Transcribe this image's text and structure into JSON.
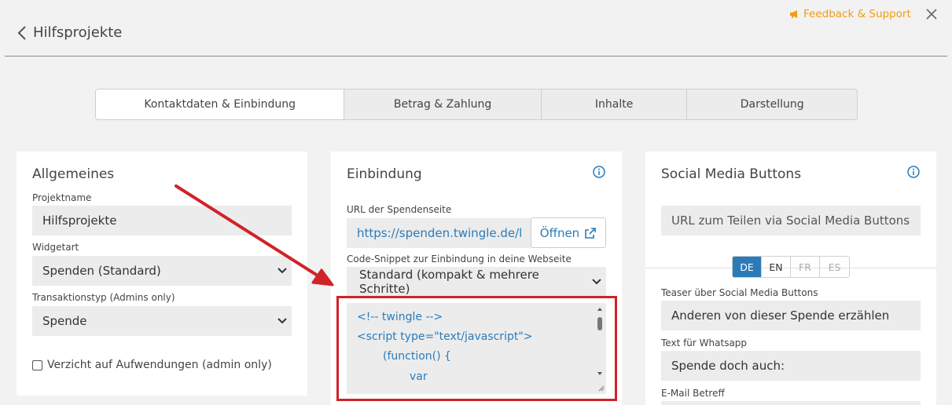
{
  "header": {
    "back_label": "Hilfsprojekte",
    "feedback_label": "Feedback & Support"
  },
  "tabs": [
    {
      "label": "Kontaktdaten & Einbindung",
      "active": true
    },
    {
      "label": "Betrag & Zahlung",
      "active": false
    },
    {
      "label": "Inhalte",
      "active": false
    },
    {
      "label": "Darstellung",
      "active": false
    }
  ],
  "general": {
    "title": "Allgemeines",
    "project_name_label": "Projektname",
    "project_name_value": "Hilfsprojekte",
    "widget_type_label": "Widgetart",
    "widget_type_value": "Spenden (Standard)",
    "transaction_type_label": "Transaktionstyp (Admins only)",
    "transaction_type_value": "Spende",
    "waiver_label": "Verzicht auf Aufwendungen (admin only)"
  },
  "embed": {
    "title": "Einbindung",
    "url_label": "URL der Spendenseite",
    "url_value": "https://spenden.twingle.de/l",
    "open_label": "Öffnen",
    "snippet_label": "Code-Snippet zur Einbindung in deine Webseite",
    "snippet_select_value": "Standard (kompakt & mehrere Schritte)",
    "code_lines": [
      "<!-- twingle -->",
      "<script type=\"text/javascript\">",
      "(function() {",
      "var"
    ]
  },
  "social": {
    "title": "Social Media Buttons",
    "share_url_placeholder": "URL zum Teilen via Social Media Buttons",
    "languages": [
      {
        "code": "DE",
        "active": true
      },
      {
        "code": "EN",
        "active": false
      },
      {
        "code": "FR",
        "active": false
      },
      {
        "code": "ES",
        "active": false
      }
    ],
    "teaser_label": "Teaser über Social Media Buttons",
    "teaser_value": "Anderen von dieser Spende erzählen",
    "whatsapp_label": "Text für Whatsapp",
    "whatsapp_value": "Spende doch auch:",
    "email_subject_label": "E-Mail Betreff"
  },
  "colors": {
    "accent": "#2b7bb9",
    "feedback": "#f39c12",
    "highlight": "#d0222a"
  }
}
